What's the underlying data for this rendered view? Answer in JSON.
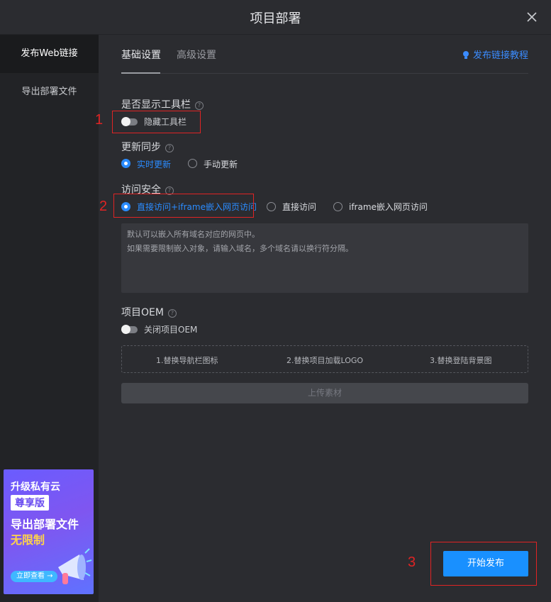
{
  "dialog": {
    "title": "项目部署"
  },
  "sidebar": {
    "items": [
      {
        "label": "发布Web链接",
        "active": true
      },
      {
        "label": "导出部署文件",
        "active": false
      }
    ],
    "promo": {
      "line1": "升级私有云",
      "badge": "尊享版",
      "line3": "导出部署文件",
      "line4": "无限制",
      "button": "立即查看 →"
    }
  },
  "tabs": [
    {
      "label": "基础设置",
      "active": true
    },
    {
      "label": "高级设置",
      "active": false
    }
  ],
  "tutorial_link": "发布链接教程",
  "toolbar_setting": {
    "label": "是否显示工具栏",
    "switch_label": "隐藏工具栏",
    "enabled": false
  },
  "sync_setting": {
    "label": "更新同步",
    "options": [
      "实时更新",
      "手动更新"
    ],
    "selected": "实时更新"
  },
  "security_setting": {
    "label": "访问安全",
    "options": [
      "直接访问+iframe嵌入网页访问",
      "直接访问",
      "iframe嵌入网页访问"
    ],
    "selected": "直接访问+iframe嵌入网页访问",
    "textarea_placeholder_line1": "默认可以嵌入所有域名对应的网页中。",
    "textarea_placeholder_line2": "如果需要限制嵌入对象，请输入域名，多个域名请以换行符分隔。"
  },
  "oem_setting": {
    "label": "项目OEM",
    "switch_label": "关闭项目OEM",
    "enabled": false,
    "items": [
      "1.替换导航栏图标",
      "2.替换项目加载LOGO",
      "3.替换登陆背景图"
    ],
    "upload_label": "上传素材"
  },
  "publish_button": "开始发布",
  "annotations": [
    "1",
    "2",
    "3"
  ],
  "colors": {
    "accent": "#1990ff",
    "annotation": "#e02424",
    "background": "#2b2c30",
    "sidebar": "#222326"
  }
}
